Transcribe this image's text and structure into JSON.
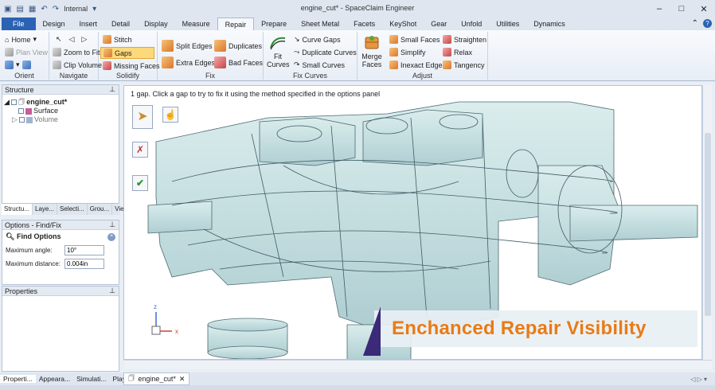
{
  "titlebar": {
    "title": "engine_cut* - SpaceClaim Engineer",
    "quick_access_label": "Internal",
    "minimize": "–",
    "maximize": "□",
    "close": "✕"
  },
  "tabs": [
    "File",
    "Design",
    "Insert",
    "Detail",
    "Display",
    "Measure",
    "Repair",
    "Prepare",
    "Sheet Metal",
    "Facets",
    "KeyShot",
    "Gear",
    "Unfold",
    "Utilities",
    "Dynamics"
  ],
  "active_tab": "Repair",
  "ribbon": {
    "orient": {
      "name": "Orient",
      "home": "Home",
      "plan_view": "Plan View"
    },
    "navigate": {
      "name": "Navigate",
      "zoom_to_fit": "Zoom to Fit",
      "clip_volume": "Clip Volume"
    },
    "solidify": {
      "name": "Solidify",
      "stitch": "Stitch",
      "gaps": "Gaps",
      "missing_faces": "Missing Faces"
    },
    "fix": {
      "name": "Fix",
      "split_edges": "Split Edges",
      "extra_edges": "Extra Edges",
      "duplicates": "Duplicates",
      "bad_faces": "Bad Faces"
    },
    "fix_curves": {
      "name": "Fix Curves",
      "fit_curves": "Fit Curves",
      "curve_gaps": "Curve Gaps",
      "duplicate_curves": "Duplicate Curves",
      "small_curves": "Small Curves"
    },
    "adjust": {
      "name": "Adjust",
      "merge_faces": "Merge Faces",
      "small_faces": "Small Faces",
      "simplify": "Simplify",
      "inexact_edges": "Inexact Edges",
      "straighten": "Straighten",
      "relax": "Relax",
      "tangency": "Tangency"
    }
  },
  "structure": {
    "header": "Structure",
    "root": "engine_cut*",
    "items": [
      "Surface",
      "Volume"
    ]
  },
  "panel_tabs": [
    "Structu...",
    "Laye...",
    "Selecti...",
    "Grou...",
    "Vie..."
  ],
  "options": {
    "header": "Options - Find/Fix",
    "section": "Find Options",
    "max_angle_label": "Maximum angle:",
    "max_angle_value": "10°",
    "max_distance_label": "Maximum distance:",
    "max_distance_value": "0.004in"
  },
  "properties": {
    "header": "Properties"
  },
  "viewport": {
    "hint": "1 gap. Click a gap to try to fix it using the method specified in the options panel",
    "banner": "Enchanced Repair Visibility",
    "axis_z": "z",
    "axis_x": "x"
  },
  "bottom_tabs": [
    "Properti...",
    "Appeara...",
    "Simulati...",
    "Playback"
  ],
  "doc_tab": "engine_cut*",
  "colors": {
    "accent": "#2a62b4",
    "banner_text": "#e97b16",
    "banner_slant": "#3a2a78"
  }
}
